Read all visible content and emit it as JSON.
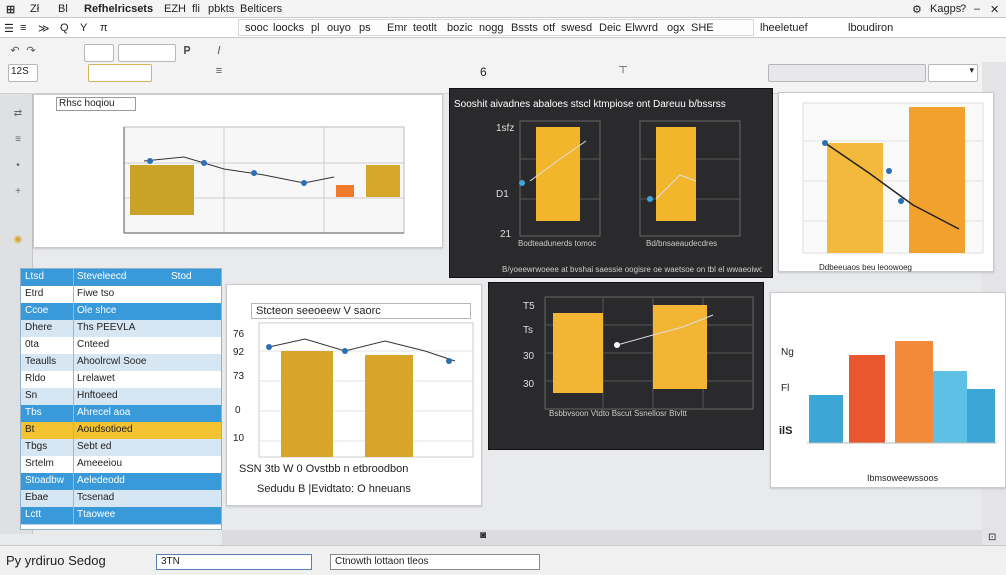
{
  "window": {
    "title_items": [
      "Zł",
      "Bl",
      "Refhelricsets",
      "EZH",
      "fli",
      "pbkts",
      "Belticers"
    ],
    "right_label": "Kagps",
    "controls": [
      "⚙",
      "?",
      "–",
      "✕"
    ]
  },
  "ribbon": {
    "left_items": [
      "☰",
      "≡",
      "≫",
      "Q",
      "Y",
      "π"
    ],
    "menus": [
      "sooc",
      "loocks",
      "pl",
      "ouyo",
      "ps",
      "Emr",
      "teotlt",
      "bozic",
      "nogg",
      "Bssts",
      "otf",
      "swesd",
      "Deic",
      "Elwvrd",
      "ogx",
      "SHE",
      "lheeletuef",
      "lboudiron"
    ]
  },
  "toolbar": {
    "page_number": "6",
    "font_size": "12S",
    "zoom_box": "",
    "icons": [
      "undo-icon",
      "redo-icon",
      "bold-icon",
      "italic-icon",
      "align-icon",
      "chart-icon"
    ]
  },
  "panels": {
    "p1": {
      "title": "Rhsc hoqiou",
      "colors": {
        "bar": "#c9a227",
        "accent": "#ef7a2a"
      }
    },
    "p2": {
      "title": "Sooshit aivadnes abaloes stscl ktmpiose ont Dareuu b/bssrss",
      "footer": "B/yoeewrwoeee at bvshai saessie oogisre oe waetsoe on tbl el wwaeoiwon",
      "ylabels": [
        "1sfz",
        "D1",
        "21"
      ],
      "xlabels": [
        "Bodteadunerds tomoc",
        "Bd/bnsaeaudecdres"
      ],
      "colors": {
        "bar": "#f1b62c",
        "bg": "#2a2a2c"
      }
    },
    "p3": {
      "title": "",
      "footer": "Ddbeeuaos beu leoowoeg",
      "colors": {
        "bar1": "#f3b93c",
        "bar2": "#f2a22c"
      }
    },
    "p4": {
      "title": "Stcteon seeoeew V saorc",
      "caption1": "SSN 3tb  W 0  Ovstbb n etbroodbon",
      "caption2": "Sedudu  B  |Evidtato: O hneuans",
      "ylabels": [
        "76",
        "92",
        "73",
        "0",
        "10"
      ],
      "colors": {
        "bar": "#d9a42a"
      }
    },
    "p5": {
      "title": "",
      "footer": "Bsbbvsoon  Vtdto  Bscut  Ssnellosr  Btvltt",
      "ylabels": [
        "T5",
        "Ts",
        "30",
        "30"
      ],
      "colors": {
        "bar": "#f2b534",
        "bg": "#2a2a2c"
      }
    },
    "p6": {
      "title": "",
      "footer": "Ibmsoweewssoos",
      "ylabels": [
        "Ng",
        "Fl",
        "ilS"
      ],
      "colors": {
        "blue": "#3ca7d6",
        "red": "#e8572e",
        "orange": "#f28a3a",
        "lightblue": "#5fc0e6"
      }
    }
  },
  "table": {
    "header": [
      "Ltsd",
      "Steveleecd",
      "Stod"
    ],
    "rows": [
      [
        "Etrd",
        "Fiwe tso"
      ],
      [
        "Ccoe",
        "Ole shce"
      ],
      [
        "Dhere",
        "Ths PEEVLA"
      ],
      [
        "0ta",
        "Cnteed"
      ],
      [
        "Teaulls",
        "Ahoolrcwl Sooe"
      ],
      [
        "Rldo",
        "Lrelawet"
      ],
      [
        "Sn",
        "Hnftoeed"
      ],
      [
        "Tbs",
        "Ahrecel aoa"
      ],
      [
        "Bt",
        "Aoudsotioed"
      ],
      [
        "Tbgs",
        "Sebt ed"
      ],
      [
        "Srtelm",
        "Ameeeiou"
      ],
      [
        "Stoadbw",
        "Aeledeodd"
      ],
      [
        "Ebae",
        "Tcsenad"
      ],
      [
        "Lctt",
        "Ttaowee"
      ]
    ],
    "colors": {
      "header": "#3a9ad9",
      "highlight": "#f2c230",
      "row": "#d6e6f3",
      "alt": "#ffffff"
    }
  },
  "status": {
    "left_text": "Py yrdiruo Sedog",
    "box1": "3TN",
    "box2": "Ctnowth lottaon tleos"
  }
}
